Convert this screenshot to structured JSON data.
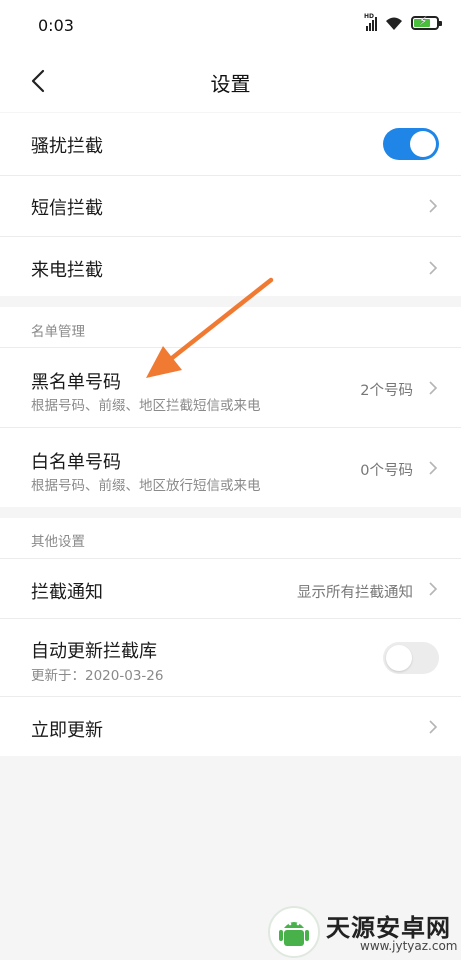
{
  "status_bar": {
    "time": "0:03",
    "network_badge": "HD",
    "icons": [
      "signal-icon",
      "wifi-icon",
      "battery-charging-icon"
    ],
    "battery_color": "#49c03c"
  },
  "header": {
    "title": "设置",
    "back_icon": "back-chevron-icon"
  },
  "group_interception": {
    "items": [
      {
        "title": "骚扰拦截",
        "control": "toggle",
        "state": "on"
      },
      {
        "title": "短信拦截",
        "control": "chevron"
      },
      {
        "title": "来电拦截",
        "control": "chevron"
      }
    ]
  },
  "group_list_management": {
    "section_label": "名单管理",
    "items": [
      {
        "title": "黑名单号码",
        "subtitle": "根据号码、前缀、地区拦截短信或来电",
        "value": "2个号码"
      },
      {
        "title": "白名单号码",
        "subtitle": "根据号码、前缀、地区放行短信或来电",
        "value": "0个号码"
      }
    ]
  },
  "group_other": {
    "section_label": "其他设置",
    "items": [
      {
        "title": "拦截通知",
        "value": "显示所有拦截通知",
        "control": "chevron"
      },
      {
        "title": "自动更新拦截库",
        "subtitle": "更新于：2020-03-26",
        "control": "toggle",
        "state": "off"
      },
      {
        "title": "立即更新",
        "control": "chevron"
      }
    ]
  },
  "colors": {
    "accent": "#1f86e8",
    "annotation_arrow": "#f07a32",
    "background": "#f5f5f5"
  },
  "watermark": {
    "name": "天源安卓网",
    "url": "www.jytyaz.com"
  }
}
